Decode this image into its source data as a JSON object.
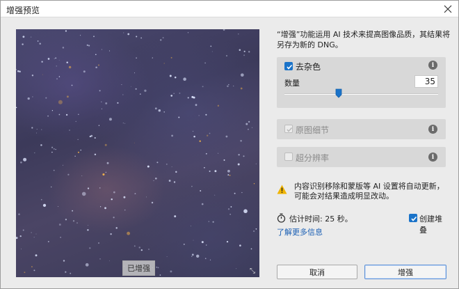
{
  "window": {
    "title": "增强预览",
    "close_label": "close"
  },
  "preview": {
    "badge": "已增强"
  },
  "description": "“增强”功能运用 AI 技术来提高图像品质，其结果将另存为新的 DNG。",
  "denoise": {
    "label": "去杂色",
    "checked": true,
    "amount_label": "数量",
    "amount_value": "35",
    "slider_fraction": 0.35
  },
  "raw_detail": {
    "label": "原图细节",
    "checked": true,
    "disabled": true
  },
  "super_resolution": {
    "label": "超分辨率",
    "checked": false,
    "disabled": true
  },
  "warning": {
    "text": "内容识别移除和蒙版等 AI 设置将自动更新，可能会对结果造成明显改动。"
  },
  "estimate": {
    "text": "估计时间: 25 秒。"
  },
  "create_stack": {
    "label": "创建堆叠",
    "checked": true
  },
  "learn_more": "了解更多信息",
  "buttons": {
    "cancel": "取消",
    "enhance": "增强"
  },
  "colors": {
    "accent": "#1a73c9",
    "link": "#1a5fb4",
    "warning": "#f0b400"
  },
  "icons": {
    "close": "close-icon",
    "info": "info-icon",
    "warning": "warning-icon",
    "timer": "stopwatch-icon",
    "checkmark": "checkmark-icon"
  }
}
